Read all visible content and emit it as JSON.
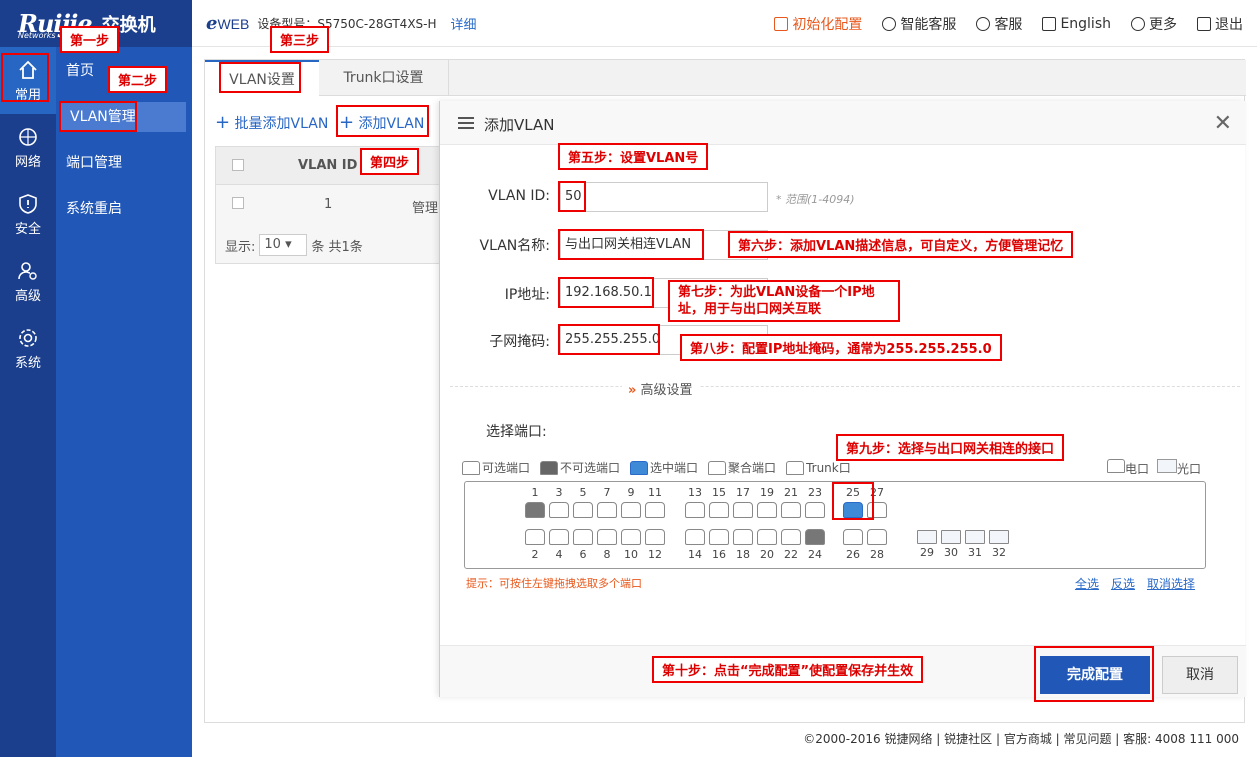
{
  "brand": {
    "logo_text": "Ruijie",
    "logo_sub": "Networks",
    "product": "交换机"
  },
  "topbar": {
    "eweb": "e",
    "eweb_rest": "WEB",
    "model_label": "设备型号：S5750C-28GT4XS-H",
    "detail": "详细",
    "init": "初始化配置",
    "smart_service": "智能客服",
    "service": "客服",
    "language": "English",
    "more": "更多",
    "logout": "退出"
  },
  "rail": [
    {
      "label": "常用"
    },
    {
      "label": "网络"
    },
    {
      "label": "安全"
    },
    {
      "label": "高级"
    },
    {
      "label": "系统"
    }
  ],
  "subnav": [
    "首页",
    "VLAN管理",
    "端口管理",
    "系统重启"
  ],
  "tabs": [
    "VLAN设置",
    "Trunk口设置"
  ],
  "toolbar": {
    "batch_add": "批量添加VLAN",
    "add": "添加VLAN"
  },
  "table": {
    "col_id": "VLAN ID",
    "row_id": "1",
    "row_name": "管理",
    "show": "显示:",
    "page_size": "10",
    "total": "条 共1条"
  },
  "dialog": {
    "title": "添加VLAN",
    "vlan_id_label": "VLAN ID:",
    "vlan_id_value": "50",
    "range_hint": "* 范围(1-4094)",
    "name_label": "VLAN名称:",
    "name_value": "与出口网关相连VLAN",
    "ip_label": "IP地址:",
    "ip_value": "192.168.50.1",
    "mask_label": "子网掩码:",
    "mask_value": "255.255.255.0",
    "advanced": "高级设置",
    "select_port": "选择端口:",
    "legend": {
      "available": "可选端口",
      "unavailable": "不可选端口",
      "selected": "选中端口",
      "aggregate": "聚合端口",
      "trunk": "Trunk口",
      "copper": "电口",
      "fiber": "光口"
    },
    "top_ports": [
      "1",
      "3",
      "5",
      "7",
      "9",
      "11",
      "13",
      "15",
      "17",
      "19",
      "21",
      "23",
      "25",
      "27"
    ],
    "bottom_ports": [
      "2",
      "4",
      "6",
      "8",
      "10",
      "12",
      "14",
      "16",
      "18",
      "20",
      "22",
      "24",
      "26",
      "28"
    ],
    "fiber_ports": [
      "29",
      "30",
      "31",
      "32"
    ],
    "tip": "提示：可按住左键拖拽选取多个端口",
    "select_all": "全选",
    "invert": "反选",
    "clear": "取消选择",
    "confirm": "完成配置",
    "cancel": "取消"
  },
  "footer": "©2000-2016 锐捷网络   |  锐捷社区  |  官方商城  |  常见问题  |   客服:   4008 111 000",
  "annotations": {
    "s1": "第一步",
    "s2": "第二步",
    "s3": "第三步",
    "s4": "第四步",
    "s5": "第五步：设置VLAN号",
    "s6": "第六步：添加VLAN描述信息，可自定义，方便管理记忆",
    "s7": "第七步：为此VLAN设备一个IP地址，用于与出口网关互联",
    "s8": "第八步：配置IP地址掩码，通常为255.255.255.0",
    "s9": "第九步：选择与出口网关相连的接口",
    "s10": "第十步：点击“完成配置”使配置保存并生效"
  }
}
